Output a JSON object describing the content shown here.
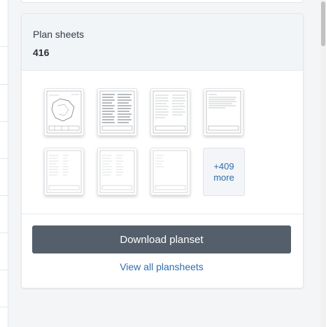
{
  "card": {
    "title": "Plan sheets",
    "count": "416"
  },
  "thumbnails": [
    {
      "name": "plan-sheet-thumbnail-1",
      "kind": "site-plan"
    },
    {
      "name": "plan-sheet-thumbnail-2",
      "kind": "dense-table"
    },
    {
      "name": "plan-sheet-thumbnail-3",
      "kind": "text-columns"
    },
    {
      "name": "plan-sheet-thumbnail-4",
      "kind": "text-block"
    },
    {
      "name": "plan-sheet-thumbnail-5",
      "kind": "sparse-table"
    },
    {
      "name": "plan-sheet-thumbnail-6",
      "kind": "sparse-table"
    },
    {
      "name": "plan-sheet-thumbnail-7",
      "kind": "blank-table"
    }
  ],
  "more_tile": {
    "count": "+409",
    "label": "more"
  },
  "actions": {
    "download_label": "Download planset",
    "view_all_label": "View all plansheets"
  },
  "colors": {
    "button": "#555f6b",
    "link": "#2f6dad",
    "header_bg": "#f2f5f8"
  }
}
